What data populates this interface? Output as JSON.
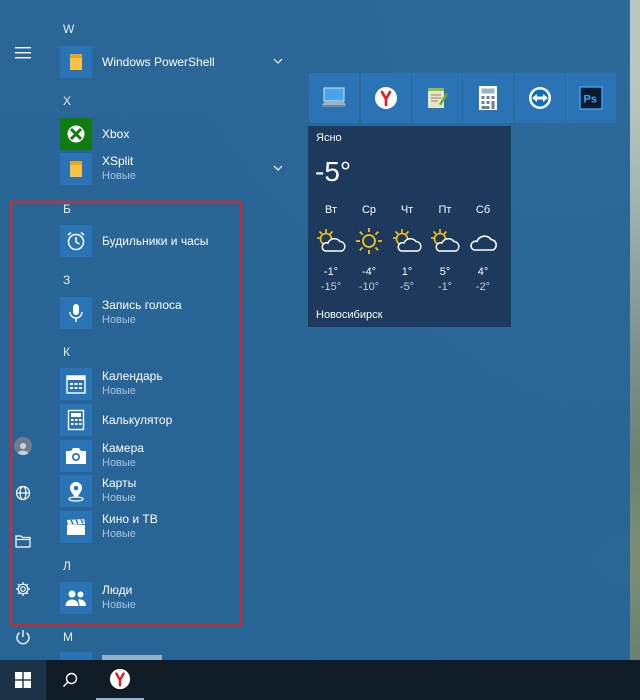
{
  "colors": {
    "accent": "#2a74b6",
    "menu_bg": "#276597",
    "highlight": "#d9262c"
  },
  "app_list": {
    "letter_w": "W",
    "powershell": "Windows PowerShell",
    "letter_x": "X",
    "xbox": "Xbox",
    "xsplit": "XSplit",
    "xsplit_sub": "Новые",
    "letter_b": "Б",
    "alarms": "Будильники и часы",
    "letter_z": "З",
    "voice": "Запись голоса",
    "voice_sub": "Новые",
    "letter_k": "К",
    "calendar": "Календарь",
    "calendar_sub": "Новые",
    "calculator": "Калькулятор",
    "camera": "Камера",
    "camera_sub": "Новые",
    "maps": "Карты",
    "maps_sub": "Новые",
    "movies": "Кино и ТВ",
    "movies_sub": "Новые",
    "letter_l": "Л",
    "people": "Люди",
    "people_sub": "Новые",
    "letter_m": "М"
  },
  "weather": {
    "condition": "Ясно",
    "temp": "-5°",
    "city": "Новосибирск",
    "days": [
      {
        "day": "Вт",
        "hi": "-1°",
        "lo": "-15°",
        "icon": "partly-cloudy"
      },
      {
        "day": "Ср",
        "hi": "-4°",
        "lo": "-10°",
        "icon": "sunny"
      },
      {
        "day": "Чт",
        "hi": "1°",
        "lo": "-5°",
        "icon": "partly-cloudy"
      },
      {
        "day": "Пт",
        "hi": "5°",
        "lo": "-1°",
        "icon": "partly-cloudy"
      },
      {
        "day": "Сб",
        "hi": "4°",
        "lo": "-2°",
        "icon": "cloudy"
      }
    ]
  },
  "tiles": [
    "this-pc",
    "yandex-browser",
    "notepad-plus",
    "calculator",
    "teamviewer",
    "photoshop"
  ],
  "rail": [
    "hamburger-menu",
    "user-account",
    "globe",
    "file-explorer",
    "settings",
    "power"
  ],
  "taskbar": [
    "start",
    "search",
    "yandex-browser"
  ]
}
